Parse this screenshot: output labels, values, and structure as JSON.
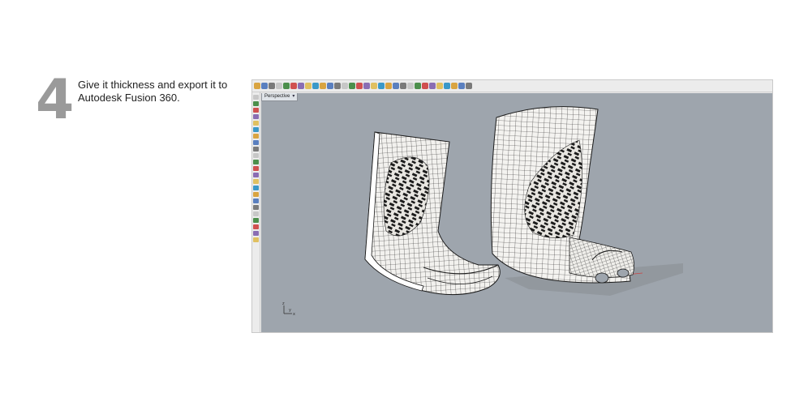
{
  "step": {
    "number": "4",
    "text": "Give it thickness and export it to Autodesk Fusion 360."
  },
  "app": {
    "viewport_tab_label": "Perspective",
    "background_color": "#9ea5ad",
    "toolbar_icons": [
      "open-icon",
      "save-icon",
      "print-icon",
      "page-icon",
      "cut-icon",
      "copy-icon",
      "paste-icon",
      "undo-icon",
      "pan-icon",
      "rotate-icon",
      "zoom-icon",
      "zoom-window-icon",
      "zoom-extents-icon",
      "zoom-selected-icon",
      "grid-icon",
      "layer-icon",
      "properties-icon",
      "point-icon",
      "curve-icon",
      "surface-icon",
      "solid-icon",
      "mesh-icon",
      "render-icon",
      "material-icon",
      "light-icon",
      "sphere-icon",
      "globe-icon",
      "settings-icon",
      "help-icon",
      "help-2-icon"
    ],
    "left_tool_icons": [
      "select-icon",
      "point-tool-icon",
      "line-tool-icon",
      "polyline-tool-icon",
      "curve-tool-icon",
      "circle-tool-icon",
      "arc-tool-icon",
      "ellipse-tool-icon",
      "rectangle-tool-icon",
      "polygon-tool-icon",
      "text-tool-icon",
      "surface-tool-icon",
      "extrude-tool-icon",
      "loft-tool-icon",
      "sweep-tool-icon",
      "solid-tool-icon",
      "boolean-tool-icon",
      "fillet-tool-icon",
      "mesh-tool-icon",
      "transform-tool-icon",
      "array-tool-icon",
      "analyze-tool-icon",
      "dimension-tool-icon"
    ],
    "axis_labels": {
      "x": "x",
      "y": "y",
      "z": "z"
    }
  }
}
